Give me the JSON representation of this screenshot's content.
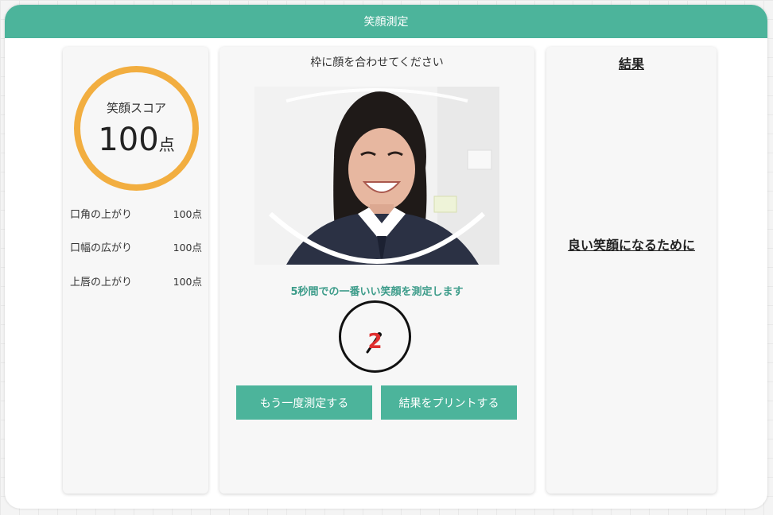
{
  "header": {
    "title": "笑顔測定"
  },
  "score_panel": {
    "ring_label": "笑顔スコア",
    "score": "100",
    "unit": "点",
    "ring_color": "#f2ae40",
    "metrics": [
      {
        "label": "口角の上がり",
        "value": "100点"
      },
      {
        "label": "口幅の広がり",
        "value": "100点"
      },
      {
        "label": "上唇の上がり",
        "value": "100点"
      }
    ]
  },
  "camera_panel": {
    "instruction": "枠に顔を合わせてください",
    "measure_note": "5秒間での一番いい笑顔を測定します",
    "countdown": "2",
    "retry_label": "もう一度測定する",
    "print_label": "結果をプリントする"
  },
  "result_panel": {
    "title": "結果",
    "tips_link": "良い笑顔になるために"
  },
  "colors": {
    "accent": "#4cb49b",
    "countdown": "#e02f2f",
    "note": "#3d9c8a"
  }
}
